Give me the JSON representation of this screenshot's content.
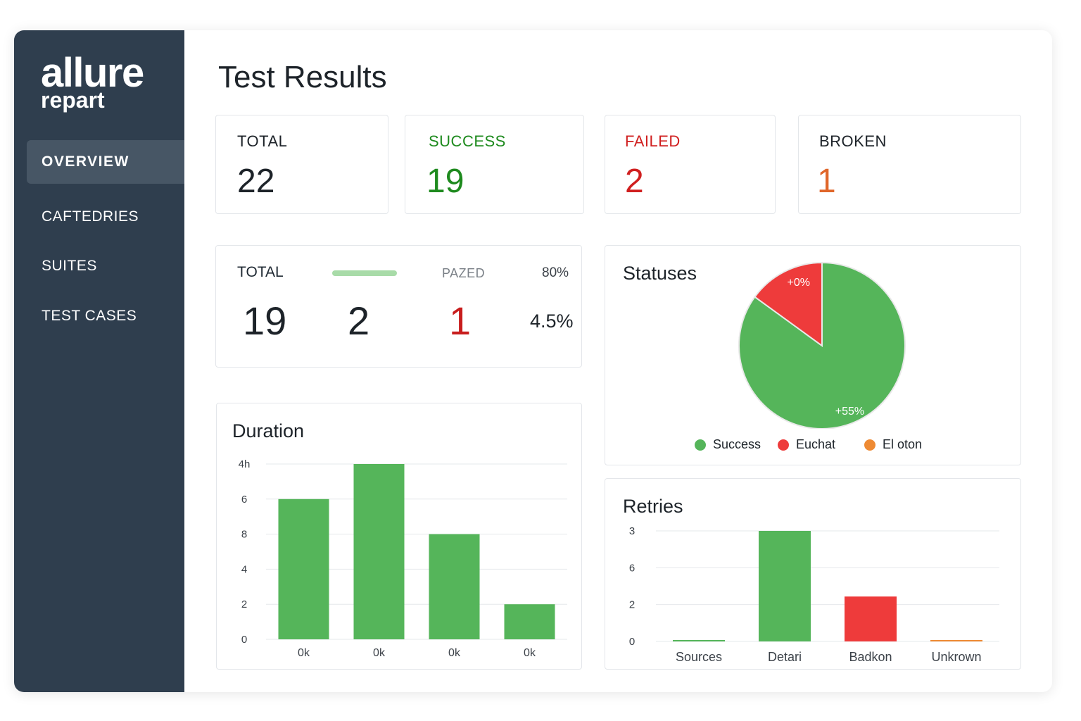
{
  "app": {
    "logo_main": "allure",
    "logo_sub": "repart"
  },
  "sidebar": {
    "items": [
      {
        "label": "OVERVIEW",
        "active": true
      },
      {
        "label": "CAFTEDRIES",
        "active": false
      },
      {
        "label": "SUITES",
        "active": false
      },
      {
        "label": "TEST CASES",
        "active": false
      }
    ]
  },
  "main": {
    "title": "Test Results",
    "stats": [
      {
        "label": "TOTAL",
        "value": "22",
        "color": "#1d2329",
        "label_color": "#1d2329"
      },
      {
        "label": "SUCCESS",
        "value": "19",
        "color": "#1e8a1e",
        "label_color": "#1e8a1e"
      },
      {
        "label": "FAILED",
        "value": "2",
        "color": "#d01f1f",
        "label_color": "#d01f1f"
      },
      {
        "label": "BROKEN",
        "value": "1",
        "color": "#e0662a",
        "label_color": "#1d2329"
      }
    ],
    "summary": {
      "labels": {
        "total": "TOTAL",
        "passed": "PAZED",
        "percent": "80%"
      },
      "values": {
        "total": "19",
        "second": "2",
        "third": "1",
        "fourth": "4.5%"
      },
      "third_color": "#c81d1d",
      "progress_color": "#a8dba8"
    }
  },
  "colors": {
    "success": "#55b55a",
    "failed": "#ee3b3b",
    "broken": "#ee8a33",
    "sidebar": "#2f3e4e"
  },
  "chart_data": [
    {
      "type": "bar",
      "title": "Duration",
      "categories": [
        "0k",
        "0k",
        "0k",
        "0k"
      ],
      "y_tick_labels": [
        "0",
        "2",
        "4",
        "8",
        "6",
        "4h"
      ],
      "values": [
        4,
        5,
        3,
        1
      ],
      "ylim": [
        0,
        5
      ],
      "color": "#55b55a",
      "grid": true
    },
    {
      "type": "pie",
      "title": "Statuses",
      "slices": [
        {
          "label": "Success",
          "value": 85,
          "color": "#55b55a",
          "text": "+55%"
        },
        {
          "label": "Euchat",
          "value": 15,
          "color": "#ee3b3b",
          "text": "+0%"
        },
        {
          "label": "El oton",
          "value": 0,
          "color": "#ee8a33",
          "text": ""
        }
      ],
      "legend_position": "bottom"
    },
    {
      "type": "bar",
      "title": "Retries",
      "categories": [
        "Sources",
        "Detari",
        "Badkon",
        "Unkrown"
      ],
      "y_tick_labels": [
        "0",
        "2",
        "6",
        "3"
      ],
      "values": [
        0,
        3.2,
        1.3,
        0
      ],
      "colors": [
        "#55b55a",
        "#55b55a",
        "#ee3b3b",
        "#ee8a33"
      ],
      "ylim": [
        0,
        3.2
      ],
      "grid": true
    }
  ]
}
